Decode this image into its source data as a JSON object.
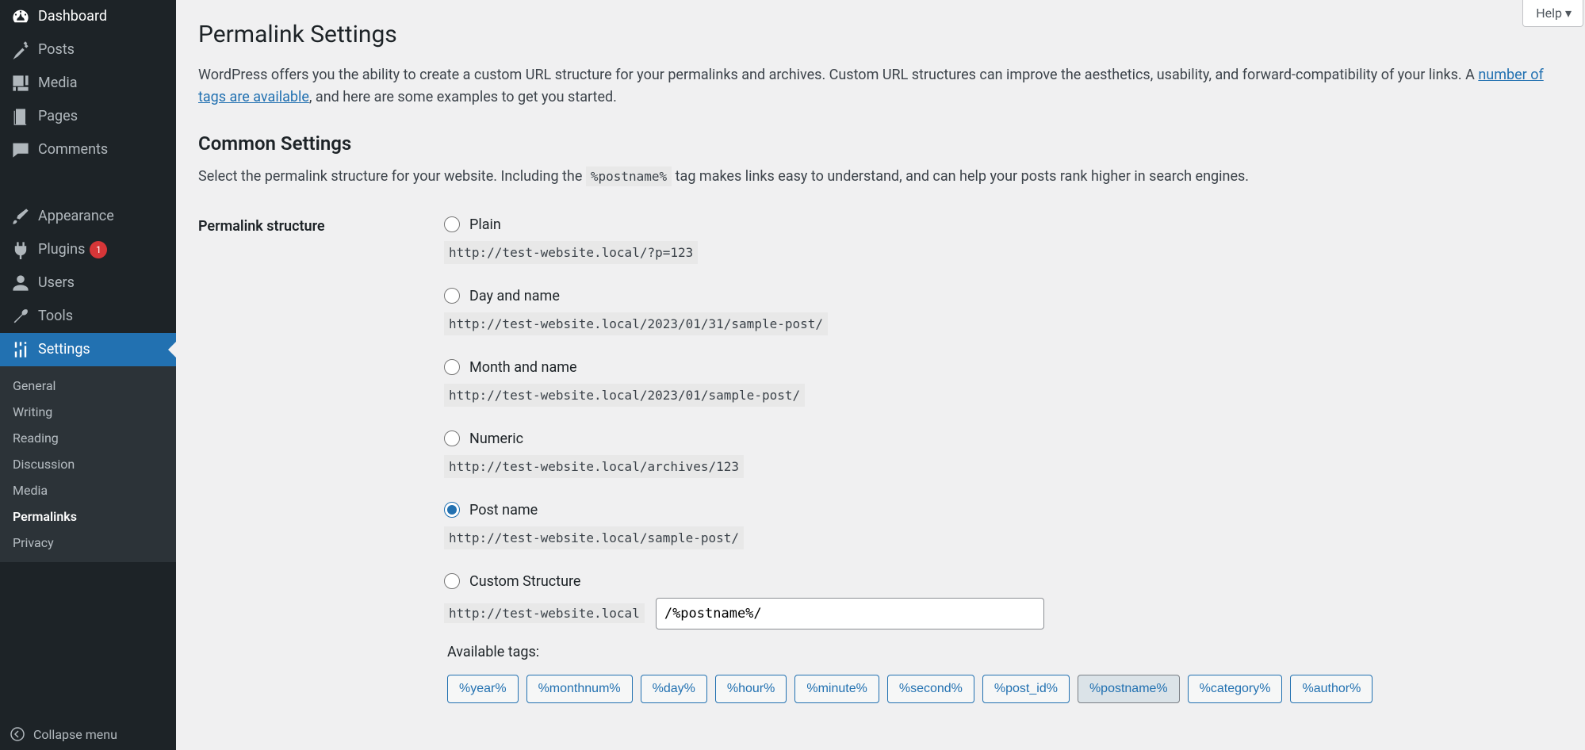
{
  "sidebar": {
    "dashboard": "Dashboard",
    "posts": "Posts",
    "media": "Media",
    "pages": "Pages",
    "comments": "Comments",
    "appearance": "Appearance",
    "plugins": "Plugins",
    "plugins_badge": "1",
    "users": "Users",
    "tools": "Tools",
    "settings": "Settings",
    "sub": {
      "general": "General",
      "writing": "Writing",
      "reading": "Reading",
      "discussion": "Discussion",
      "media": "Media",
      "permalinks": "Permalinks",
      "privacy": "Privacy"
    },
    "collapse": "Collapse menu"
  },
  "help": "Help",
  "page": {
    "title": "Permalink Settings",
    "intro_before": "WordPress offers you the ability to create a custom URL structure for your permalinks and archives. Custom URL structures can improve the aesthetics, usability, and forward-compatibility of your links. A ",
    "intro_link": "number of tags are available",
    "intro_after": ", and here are some examples to get you started.",
    "common_heading": "Common Settings",
    "select_before": "Select the permalink structure for your website. Including the ",
    "select_code": "%postname%",
    "select_after": " tag makes links easy to understand, and can help your posts rank higher in search engines.",
    "row_label": "Permalink structure"
  },
  "options": {
    "plain": {
      "label": "Plain",
      "example": "http://test-website.local/?p=123"
    },
    "day": {
      "label": "Day and name",
      "example": "http://test-website.local/2023/01/31/sample-post/"
    },
    "month": {
      "label": "Month and name",
      "example": "http://test-website.local/2023/01/sample-post/"
    },
    "numeric": {
      "label": "Numeric",
      "example": "http://test-website.local/archives/123"
    },
    "postname": {
      "label": "Post name",
      "example": "http://test-website.local/sample-post/"
    },
    "custom": {
      "label": "Custom Structure",
      "base": "http://test-website.local",
      "value": "/%postname%/",
      "available": "Available tags:"
    },
    "selected": "postname"
  },
  "tags": [
    "%year%",
    "%monthnum%",
    "%day%",
    "%hour%",
    "%minute%",
    "%second%",
    "%post_id%",
    "%postname%",
    "%category%",
    "%author%"
  ],
  "active_tag": "%postname%"
}
